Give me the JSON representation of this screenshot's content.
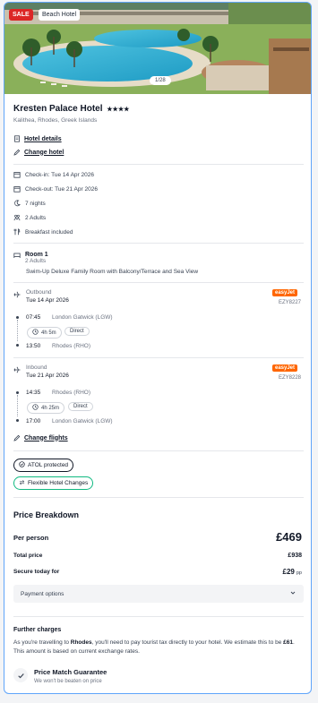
{
  "hero": {
    "sale_tag": "SALE",
    "category_tag": "Beach Hotel",
    "photo_counter": "1/28"
  },
  "hotel": {
    "name": "Kresten Palace Hotel",
    "stars": "★★★★",
    "location": "Kalithea, Rhodes, Greek Islands",
    "details_link": "Hotel details",
    "change_link": "Change hotel"
  },
  "stay": {
    "check_in": "Check-in: Tue 14 Apr 2026",
    "check_out": "Check-out: Tue 21 Apr 2026",
    "nights": "7 nights",
    "guests": "2 Adults",
    "board": "Breakfast included"
  },
  "room": {
    "title": "Room 1",
    "guests": "2 Adults",
    "description": "Swim-Up Deluxe Family Room with Balcony/Terrace and Sea View"
  },
  "flights": {
    "outbound": {
      "label": "Outbound",
      "date": "Tue 14 Apr 2026",
      "airline": "easyJet",
      "flight_no": "EZY8227",
      "dep_time": "07:45",
      "dep_airport": "London Gatwick (LGW)",
      "duration": "4h 5m",
      "stops": "Direct",
      "arr_time": "13:50",
      "arr_airport": "Rhodes (RHO)"
    },
    "inbound": {
      "label": "Inbound",
      "date": "Tue 21 Apr 2026",
      "airline": "easyJet",
      "flight_no": "EZY8228",
      "dep_time": "14:35",
      "dep_airport": "Rhodes (RHO)",
      "duration": "4h 25m",
      "stops": "Direct",
      "arr_time": "17:00",
      "arr_airport": "London Gatwick (LGW)"
    },
    "change_link": "Change flights"
  },
  "badges": {
    "atol": "ATOL protected",
    "flexible": "Flexible Hotel Changes"
  },
  "price": {
    "heading": "Price Breakdown",
    "per_person_label": "Per person",
    "per_person_value": "£469",
    "total_label": "Total price",
    "total_value": "£938",
    "secure_label": "Secure today for",
    "secure_value": "£29",
    "secure_suffix": "pp",
    "payment_options": "Payment options"
  },
  "further": {
    "heading": "Further charges",
    "text_a": "As you're travelling to ",
    "destination": "Rhodes",
    "text_b": ", you'll need to pay tourist tax directly to your hotel. We estimate this to be ",
    "amount": "£61",
    "text_c": ". This amount is based on current exchange rates."
  },
  "guarantee": {
    "title": "Price Match Guarantee",
    "subtitle": "We won't be beaten on price"
  },
  "colors": {
    "sale": "#dc2626",
    "easyjet": "#ff6600",
    "accent_border": "#60a5fa",
    "flexible_border": "#10b981"
  }
}
